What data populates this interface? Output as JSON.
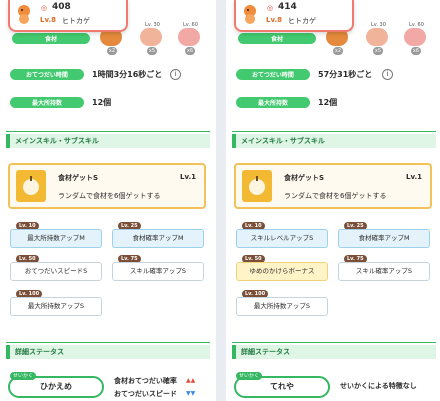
{
  "left": {
    "header": {
      "cp": "408",
      "level": "Lv.8",
      "name": "ヒトカゲ"
    },
    "ingredients": {
      "label": "食材",
      "items": [
        {
          "level": "",
          "count": "x2",
          "color": "#e58a3c"
        },
        {
          "level": "Lv. 30",
          "count": "x5",
          "color": "#f1b49b"
        },
        {
          "level": "Lv. 60",
          "count": "x6",
          "color": "#f2a9a5"
        }
      ]
    },
    "stats": [
      {
        "label": "おてつだい時間",
        "value": "1時間3分16秒ごと",
        "info": "i"
      },
      {
        "label": "最大所持数",
        "value": "12個"
      }
    ],
    "section_skill": "メインスキル・サブスキル",
    "main_skill": {
      "name": "食材ゲットS",
      "level": "Lv.1",
      "desc": "ランダムで食材を6個ゲットする"
    },
    "sub_skills": [
      {
        "level": "Lv. 10",
        "name": "最大所持数アップM",
        "style": "blue"
      },
      {
        "level": "Lv. 25",
        "name": "食材確率アップM",
        "style": "blue"
      },
      {
        "level": "Lv. 50",
        "name": "おてつだいスピードS",
        "style": "plain"
      },
      {
        "level": "Lv. 75",
        "name": "スキル確率アップS",
        "style": "plain"
      },
      {
        "level": "Lv. 100",
        "name": "最大所持数アップS",
        "style": "plain"
      }
    ],
    "section_detail": "詳細ステータス",
    "nature": {
      "badge": "せいかく",
      "name": "ひかえめ"
    },
    "nature_effects": [
      {
        "label": "食材おてつだい確率",
        "arrow": "▲▲",
        "color": "#e24c3c"
      },
      {
        "label": "おてつだいスピード",
        "arrow": "▼▼",
        "color": "#3c8be2"
      }
    ]
  },
  "right": {
    "header": {
      "cp": "414",
      "level": "Lv.8",
      "name": "ヒトカゲ"
    },
    "ingredients": {
      "label": "食材",
      "items": [
        {
          "level": "",
          "count": "x2",
          "color": "#e58a3c"
        },
        {
          "level": "Lv. 30",
          "count": "x5",
          "color": "#f1b49b"
        },
        {
          "level": "Lv. 60",
          "count": "x6",
          "color": "#f2a9a5"
        }
      ]
    },
    "stats": [
      {
        "label": "おてつだい時間",
        "value": "57分31秒ごと",
        "info": "i"
      },
      {
        "label": "最大所持数",
        "value": "12個"
      }
    ],
    "section_skill": "メインスキル・サブスキル",
    "main_skill": {
      "name": "食材ゲットS",
      "level": "Lv.1",
      "desc": "ランダムで食材を6個ゲットする"
    },
    "sub_skills": [
      {
        "level": "Lv. 10",
        "name": "スキルレベルアップS",
        "style": "blue"
      },
      {
        "level": "Lv. 25",
        "name": "食材確率アップM",
        "style": "blue"
      },
      {
        "level": "Lv. 50",
        "name": "ゆめのかけらボーナス",
        "style": "gold"
      },
      {
        "level": "Lv. 75",
        "name": "スキル確率アップS",
        "style": "plain"
      },
      {
        "level": "Lv. 100",
        "name": "最大所持数アップS",
        "style": "plain"
      }
    ],
    "section_detail": "詳細ステータス",
    "nature": {
      "badge": "せいかく",
      "name": "てれや"
    },
    "nature_effects": [
      {
        "label": "せいかくによる特徴なし",
        "arrow": "",
        "color": "#2c2c2c"
      }
    ]
  },
  "colors": {
    "accent_green": "#36b862",
    "header_border": "#ef7b6f",
    "skill_gold": "#f3c15a"
  }
}
